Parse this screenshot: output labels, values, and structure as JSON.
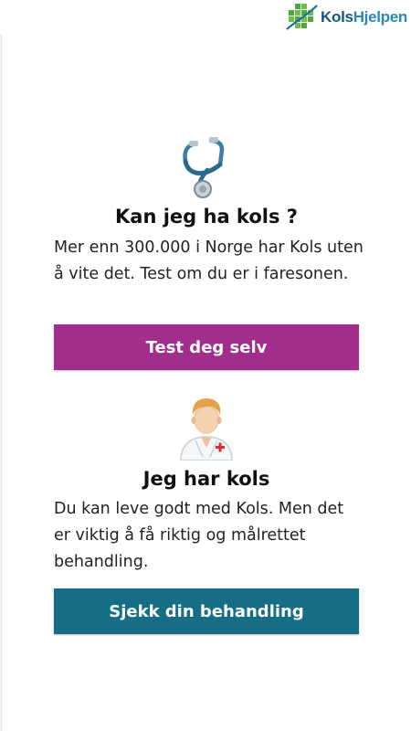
{
  "header": {
    "logo_part1": "Kols",
    "logo_part2": "Hjelpen"
  },
  "section_test": {
    "icon": "stethoscope-icon",
    "title": "Kan jeg ha kols ?",
    "text": "Mer enn 300.000 i Norge har Kols uten å vite det. Test om du er i faresonen.",
    "button_label": "Test deg selv",
    "button_color": "#a12e8c"
  },
  "section_have": {
    "icon": "doctor-icon",
    "title": "Jeg har kols",
    "text": "Du kan leve godt med Kols. Men det er viktig å få riktig og målrettet behandling.",
    "button_label": "Sjekk din behandling",
    "button_color": "#156e86"
  }
}
